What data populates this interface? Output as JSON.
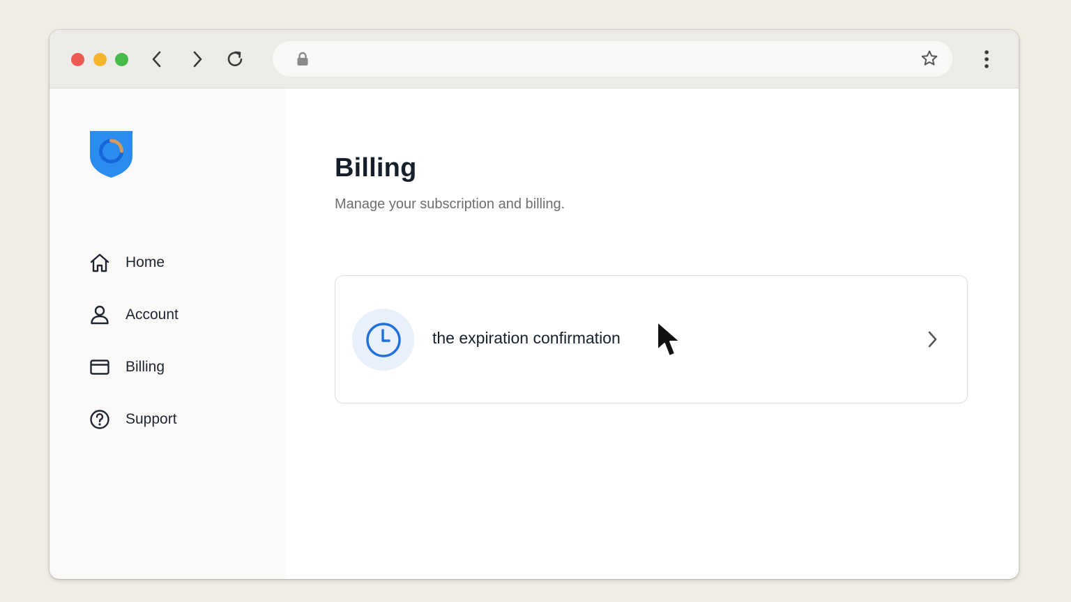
{
  "browser": {
    "address_value": "",
    "icons": {
      "close_dot": "#ee5a52",
      "minimize_dot": "#f4b42b",
      "maximize_dot": "#46bb48",
      "back": "chevron-left-icon",
      "forward": "chevron-right-icon",
      "reload": "reload-icon",
      "lock": "lock-icon",
      "bookmark": "star-icon",
      "menu": "more-vertical-icon"
    }
  },
  "sidebar": {
    "logo_icon": "shield-logo-icon",
    "items": [
      {
        "label": "Home",
        "icon": "home-icon"
      },
      {
        "label": "Account",
        "icon": "user-icon"
      },
      {
        "label": "Billing",
        "icon": "credit-card-icon"
      },
      {
        "label": "Support",
        "icon": "help-circle-icon"
      }
    ]
  },
  "main": {
    "title": "Billing",
    "subtitle": "Manage your subscription and billing.",
    "card": {
      "label": "the expiration confirmation",
      "icon": "clock-icon",
      "trailing_icon": "chevron-right-icon"
    }
  },
  "colors": {
    "accent": "#1f6fdc",
    "logo_blue": "#2b8cf0"
  }
}
